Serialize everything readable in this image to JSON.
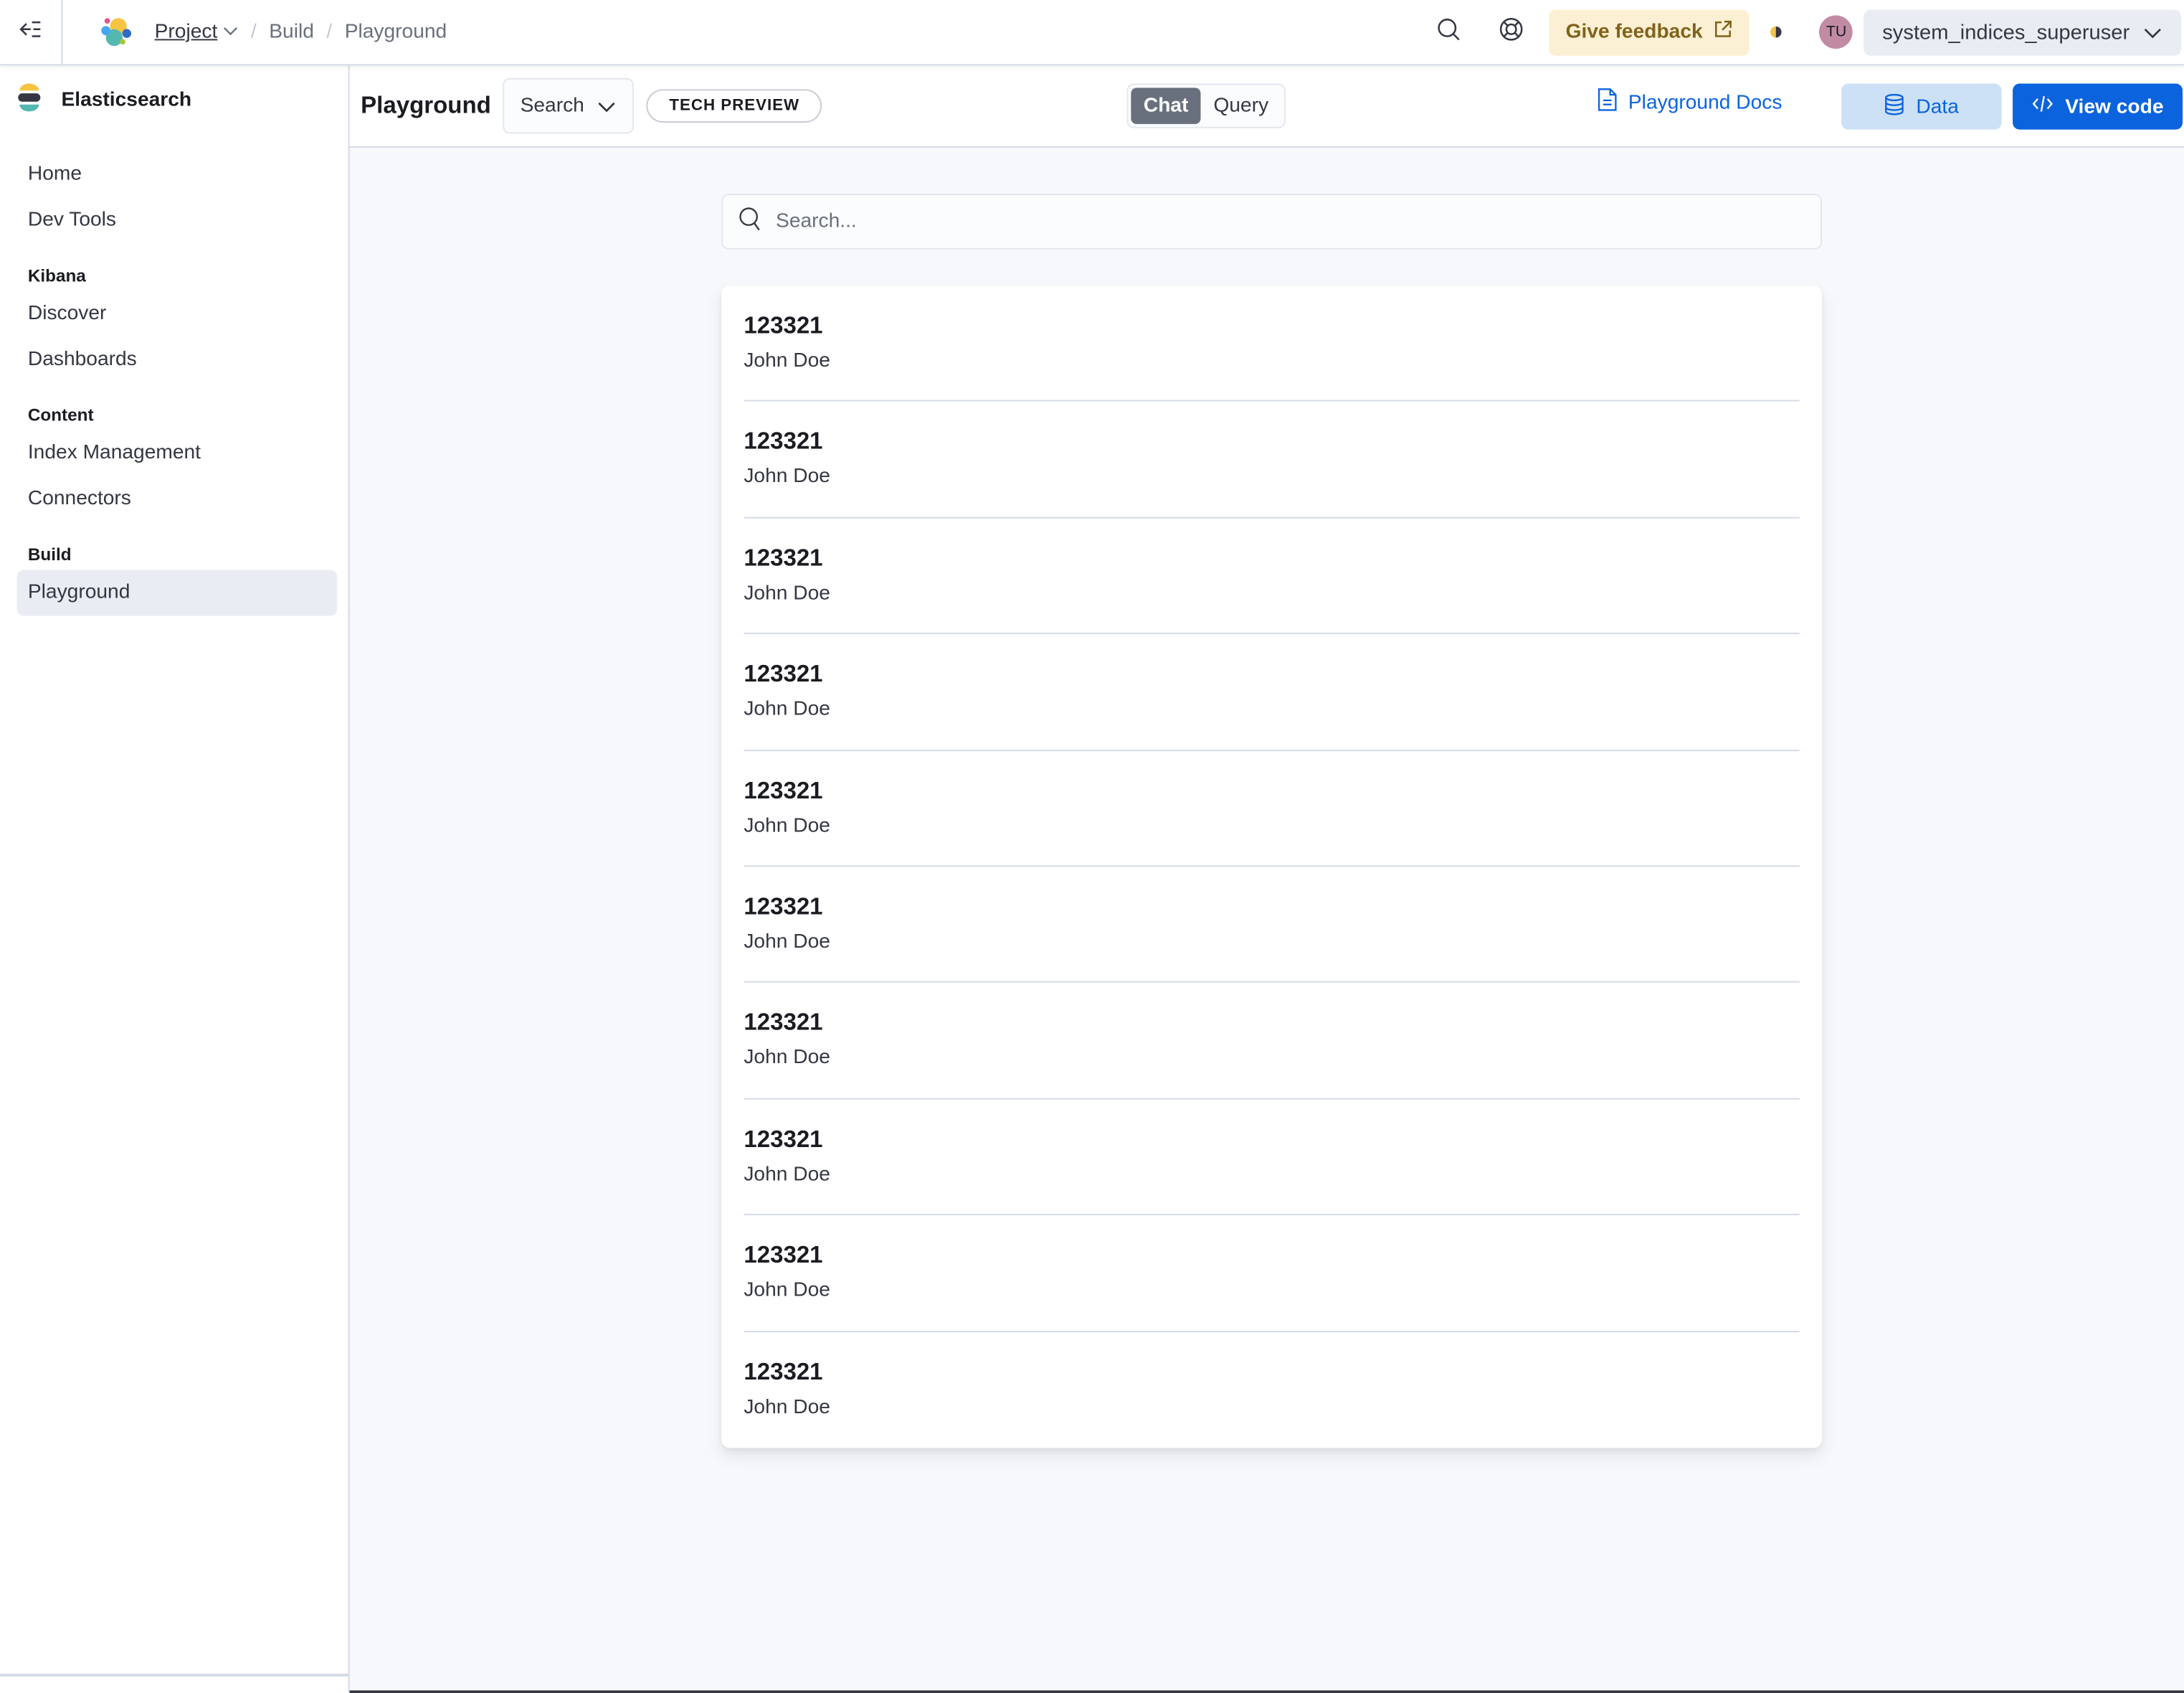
{
  "topbar": {
    "breadcrumbs": [
      "Project",
      "Build",
      "Playground"
    ],
    "feedback_label": "Give feedback",
    "avatar_initials": "TU",
    "user_name": "system_indices_superuser"
  },
  "sidebar": {
    "title": "Elasticsearch",
    "items_top": [
      {
        "label": "Home"
      },
      {
        "label": "Dev Tools"
      }
    ],
    "groups": [
      {
        "title": "Kibana",
        "items": [
          {
            "label": "Discover"
          },
          {
            "label": "Dashboards"
          }
        ]
      },
      {
        "title": "Content",
        "items": [
          {
            "label": "Index Management"
          },
          {
            "label": "Connectors"
          }
        ]
      },
      {
        "title": "Build",
        "items": [
          {
            "label": "Playground",
            "active": true
          }
        ]
      }
    ]
  },
  "page_header": {
    "title": "Playground",
    "mode_select": "Search",
    "badge": "TECH PREVIEW",
    "toggle": [
      {
        "label": "Chat",
        "selected": true
      },
      {
        "label": "Query",
        "selected": false
      }
    ],
    "docs_link": "Playground Docs",
    "data_button": "Data",
    "view_code_button": "View code"
  },
  "search": {
    "placeholder": "Search...",
    "value": ""
  },
  "results": [
    {
      "id": "123321",
      "name": "John Doe"
    },
    {
      "id": "123321",
      "name": "John Doe"
    },
    {
      "id": "123321",
      "name": "John Doe"
    },
    {
      "id": "123321",
      "name": "John Doe"
    },
    {
      "id": "123321",
      "name": "John Doe"
    },
    {
      "id": "123321",
      "name": "John Doe"
    },
    {
      "id": "123321",
      "name": "John Doe"
    },
    {
      "id": "123321",
      "name": "John Doe"
    },
    {
      "id": "123321",
      "name": "John Doe"
    },
    {
      "id": "123321",
      "name": "John Doe"
    }
  ],
  "colors": {
    "primary": "#0b64dd",
    "primary_light": "#cce1f5",
    "feedback_bg": "#fcf0d4",
    "feedback_text": "#80621b",
    "avatar": "#c28ba4"
  }
}
